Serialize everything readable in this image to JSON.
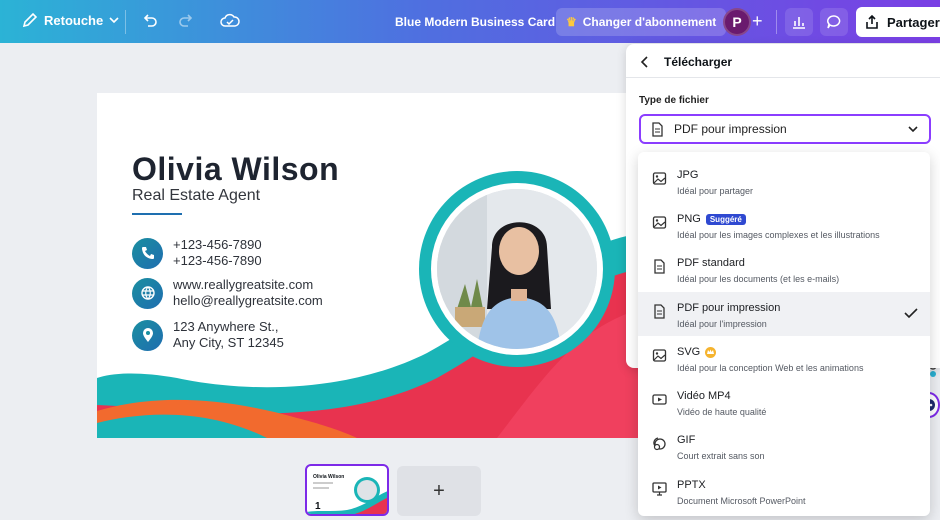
{
  "topbar": {
    "retouche_label": "Retouche",
    "doc_title": "Blue Modern Business Card",
    "upgrade_label": "Changer d'abonnement",
    "avatar_initial": "P",
    "share_label": "Partager"
  },
  "card": {
    "name": "Olivia Wilson",
    "role": "Real Estate Agent",
    "phone1": "+123-456-7890",
    "phone2": "+123-456-7890",
    "website": "www.reallygreatsite.com",
    "email": "hello@reallygreatsite.com",
    "address1": "123 Anywhere St.,",
    "address2": "Any City, ST 12345"
  },
  "thumbnail": {
    "name": "Olivia Wilson",
    "page_number": "1",
    "add_label": "+"
  },
  "panel": {
    "title": "Télécharger",
    "file_type_label": "Type de fichier",
    "selected_value": "PDF pour impression"
  },
  "file_types": [
    {
      "title": "JPG",
      "desc": "Idéal pour partager",
      "icon": "image-icon"
    },
    {
      "title": "PNG",
      "badge": "Suggéré",
      "desc": "Idéal pour les images complexes et les illustrations",
      "icon": "image-icon"
    },
    {
      "title": "PDF standard",
      "desc": "Idéal pour les documents (et les e-mails)",
      "icon": "document-icon"
    },
    {
      "title": "PDF pour impression",
      "desc": "Idéal pour l'impression",
      "icon": "document-icon",
      "selected": true
    },
    {
      "title": "SVG",
      "desc": "Idéal pour la conception Web et les animations",
      "icon": "image-icon",
      "pro": true
    },
    {
      "title": "Vidéo MP4",
      "desc": "Vidéo de haute qualité",
      "icon": "video-icon"
    },
    {
      "title": "GIF",
      "desc": "Court extrait sans son",
      "icon": "gif-icon"
    },
    {
      "title": "PPTX",
      "desc": "Document Microsoft PowerPoint",
      "icon": "presentation-icon"
    }
  ],
  "colors": {
    "accent": "#8b3dff",
    "card_teal": "#1ab5b7",
    "card_red": "#e8334f",
    "card_orange": "#f26a2e"
  }
}
